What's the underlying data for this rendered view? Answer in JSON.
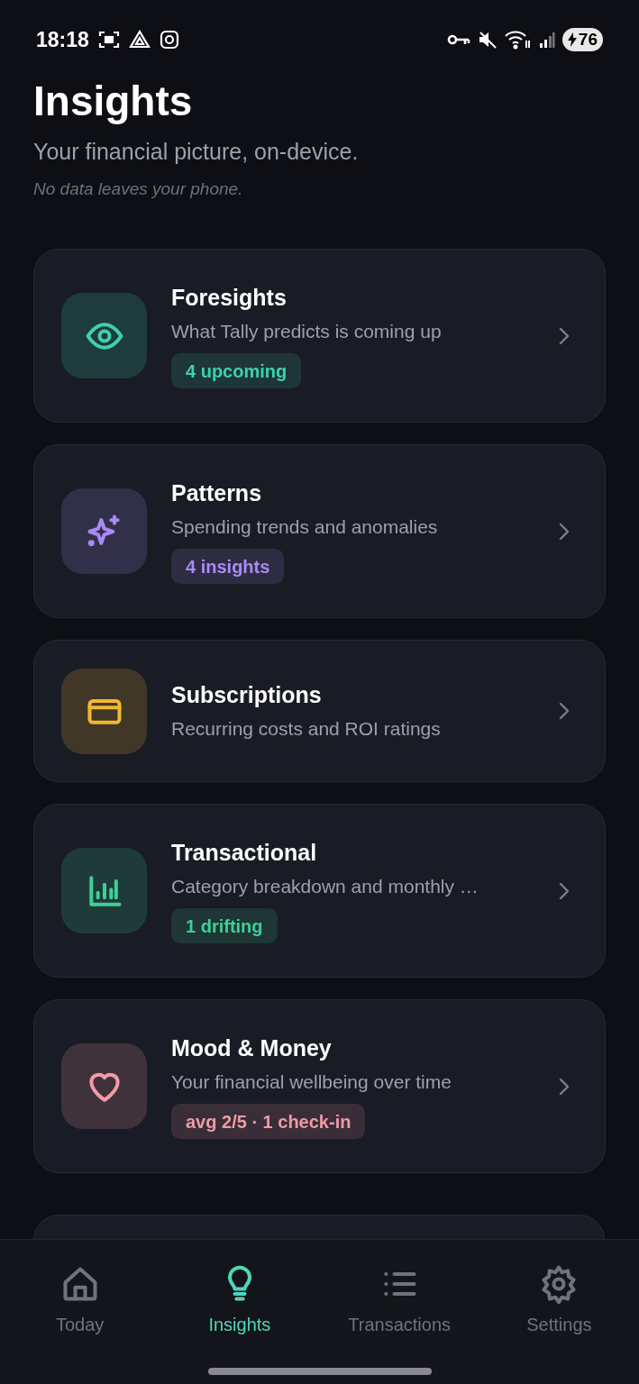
{
  "status_bar": {
    "time": "18:18",
    "battery": "76"
  },
  "header": {
    "title": "Insights",
    "subtitle": "Your financial picture, on-device.",
    "note": "No data leaves your phone."
  },
  "cards": [
    {
      "kind": "eye",
      "color": "#3fd0b0",
      "title": "Foresights",
      "subtitle": "What Tally predicts is coming up",
      "badge": "4 upcoming"
    },
    {
      "kind": "sparkle",
      "color": "#a98af5",
      "title": "Patterns",
      "subtitle": "Spending trends and anomalies",
      "badge": "4 insights"
    },
    {
      "kind": "card",
      "color": "#f2b833",
      "title": "Subscriptions",
      "subtitle": "Recurring costs and ROI ratings"
    },
    {
      "kind": "chart",
      "color": "#3fcf9a",
      "title": "Transactional",
      "subtitle": "Category breakdown and monthly …",
      "badge": "1 drifting"
    },
    {
      "kind": "heart",
      "color": "#f29aa8",
      "title": "Mood & Money",
      "subtitle": "Your financial wellbeing over time",
      "badge": "avg 2/5 · 1 check-in"
    }
  ],
  "tabs": [
    {
      "kind": "home",
      "label": "Today",
      "selected": false
    },
    {
      "kind": "bulb",
      "label": "Insights",
      "selected": true
    },
    {
      "kind": "list",
      "label": "Transactions",
      "selected": false
    },
    {
      "kind": "gear",
      "label": "Settings",
      "selected": false
    }
  ]
}
